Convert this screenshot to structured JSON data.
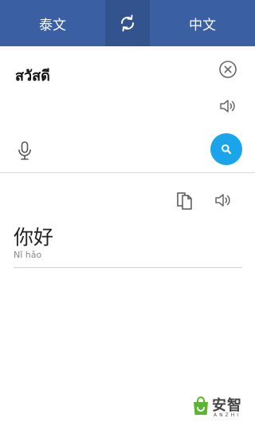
{
  "header": {
    "source_lang": "泰文",
    "target_lang": "中文",
    "swap_icon": "swap-arrows-icon"
  },
  "input": {
    "text": "สวัสดี",
    "clear_icon": "clear-icon",
    "speak_icon": "speaker-icon",
    "mic_icon": "microphone-icon",
    "search_icon": "search-icon"
  },
  "result": {
    "text": "你好",
    "pinyin": "Nǐ hǎo",
    "copy_icon": "copy-icon",
    "speak_icon": "speaker-icon"
  },
  "watermark": {
    "cn": "安智",
    "en": "ANZHI"
  },
  "colors": {
    "header_bg": "#3b5fa3",
    "swap_bg": "#33538f",
    "search_button": "#1aa5ea",
    "watermark_green": "#5cb531"
  }
}
